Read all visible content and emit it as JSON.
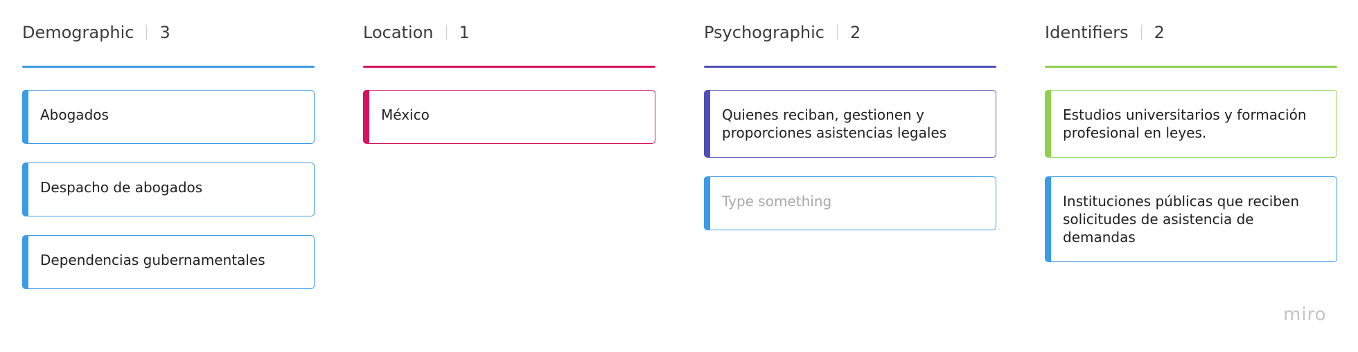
{
  "colors": {
    "demographic": "#3a9be6",
    "location": "#d6135f",
    "psychographic": "#4d4fb8",
    "identifiers": "#8fd14f",
    "default_card": "#3a9be6"
  },
  "columns": [
    {
      "title": "Demographic",
      "count": "3",
      "cards": [
        {
          "text": "Abogados"
        },
        {
          "text": "Despacho de abogados"
        },
        {
          "text": "Dependencias gubernamentales"
        }
      ]
    },
    {
      "title": "Location",
      "count": "1",
      "cards": [
        {
          "text": "México"
        }
      ]
    },
    {
      "title": "Psychographic",
      "count": "2",
      "cards": [
        {
          "text": "Quienes reciban, gestionen y proporciones asistencias legales"
        },
        {
          "text": "Type something"
        }
      ]
    },
    {
      "title": "Identifiers",
      "count": "2",
      "cards": [
        {
          "text": "Estudios universitarios y formación profesional en leyes."
        },
        {
          "text": "Instituciones públicas que reciben solicitudes de asistencia de demandas"
        }
      ]
    }
  ],
  "brand": {
    "logo_text": "miro"
  }
}
